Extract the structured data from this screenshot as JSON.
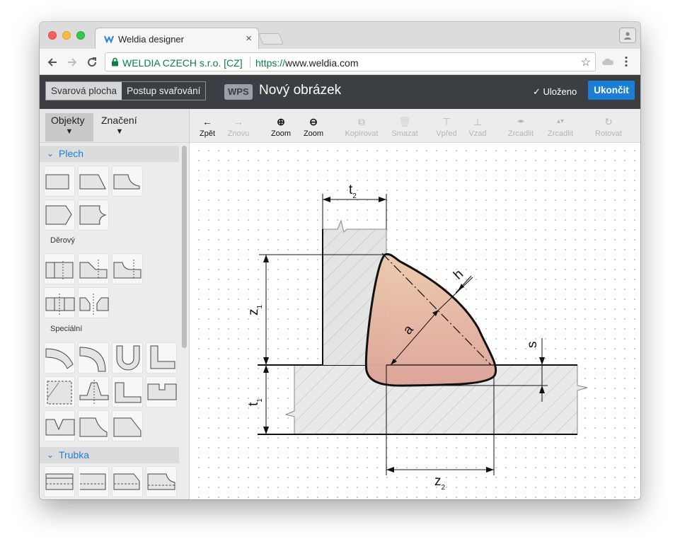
{
  "browser": {
    "tab_title": "Weldia designer",
    "tab_close": "×",
    "secure_label": "WELDIA CZECH s.r.o. [CZ]",
    "url_scheme": "https://",
    "url_host": "www.weldia.com",
    "icons": [
      "back-arrow-icon",
      "forward-arrow-icon",
      "reload-icon",
      "lock-icon",
      "star-icon",
      "cloud-extension-icon",
      "kebab-menu-icon",
      "profile-icon"
    ]
  },
  "header": {
    "mode_tabs": [
      {
        "label": "Svarová plocha",
        "active": true
      },
      {
        "label": "Postup svařování",
        "active": false
      }
    ],
    "badge": "WPS",
    "title": "Nový obrázek",
    "saved": "✓ Uloženo",
    "finish": "Ukončit",
    "colors": {
      "header_bg": "#3b3e42",
      "accent": "#1a7fd4"
    }
  },
  "sidebar": {
    "tabs": [
      {
        "label": "Objekty",
        "arrow": "▼",
        "active": true
      },
      {
        "label": "Značení",
        "arrow": "▼",
        "active": false
      }
    ],
    "sections": [
      {
        "chevron": "⌄",
        "name": "Plech",
        "subsections": [
          "Děrový",
          "Speciální"
        ]
      },
      {
        "chevron": "⌄",
        "name": "Trubka"
      }
    ]
  },
  "toolbar": {
    "tools": [
      {
        "glyph": "←",
        "label": "Zpět",
        "enabled": true
      },
      {
        "glyph": "→",
        "label": "Znovu",
        "enabled": false
      },
      {
        "glyph": "⊕",
        "label": "Zoom",
        "enabled": true
      },
      {
        "glyph": "⊖",
        "label": "Zoom",
        "enabled": true
      },
      {
        "glyph": "⧉",
        "label": "Kopírovat",
        "enabled": false
      },
      {
        "glyph": "🗑",
        "label": "Smazat",
        "enabled": false
      },
      {
        "glyph": "⊤",
        "label": "Vpřed",
        "enabled": false
      },
      {
        "glyph": "⊥",
        "label": "Vzad",
        "enabled": false
      },
      {
        "glyph": "◂▸",
        "label": "Zrcadlit",
        "enabled": false
      },
      {
        "glyph": "▴▾",
        "label": "Zrcadlit",
        "enabled": false
      },
      {
        "glyph": "↻",
        "label": "Rotovat",
        "enabled": false
      }
    ]
  },
  "drawing": {
    "labels": [
      {
        "main": "t",
        "sub": "2"
      },
      {
        "main": "z",
        "sub": "1"
      },
      {
        "main": "t",
        "sub": "1"
      },
      {
        "main": "z",
        "sub": "2"
      },
      {
        "main": "h",
        "sub": ""
      },
      {
        "main": "a",
        "sub": ""
      },
      {
        "main": "s",
        "sub": ""
      }
    ],
    "colors": {
      "weld_top": "#ecc8aa",
      "weld_bottom": "#dca196",
      "plate_fill": "#e9e9e9",
      "outline": "#111111"
    }
  }
}
